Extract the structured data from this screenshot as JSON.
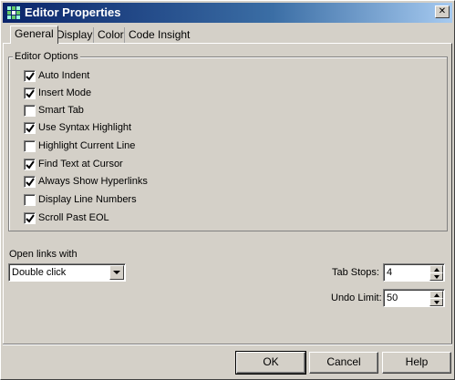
{
  "window": {
    "title": "Editor Properties",
    "close_label": "✕"
  },
  "tabs": [
    {
      "label": "General",
      "active": true
    },
    {
      "label": "Display",
      "active": false
    },
    {
      "label": "Color",
      "active": false
    },
    {
      "label": "Code Insight",
      "active": false
    }
  ],
  "editor_options": {
    "label": "Editor Options",
    "items": [
      {
        "label": "Auto Indent",
        "checked": true
      },
      {
        "label": "Insert Mode",
        "checked": true
      },
      {
        "label": "Smart Tab",
        "checked": false
      },
      {
        "label": "Use Syntax Highlight",
        "checked": true
      },
      {
        "label": "Highlight Current Line",
        "checked": false
      },
      {
        "label": "Find Text at Cursor",
        "checked": true
      },
      {
        "label": "Always Show Hyperlinks",
        "checked": true
      },
      {
        "label": "Display Line Numbers",
        "checked": false
      },
      {
        "label": "Scroll Past EOL",
        "checked": true
      }
    ]
  },
  "open_links": {
    "label": "Open links with",
    "value": "Double click"
  },
  "tab_stops": {
    "label": "Tab Stops:",
    "value": "4"
  },
  "undo_limit": {
    "label": "Undo Limit:",
    "value": "50"
  },
  "buttons": {
    "ok": "OK",
    "cancel": "Cancel",
    "help": "Help"
  }
}
